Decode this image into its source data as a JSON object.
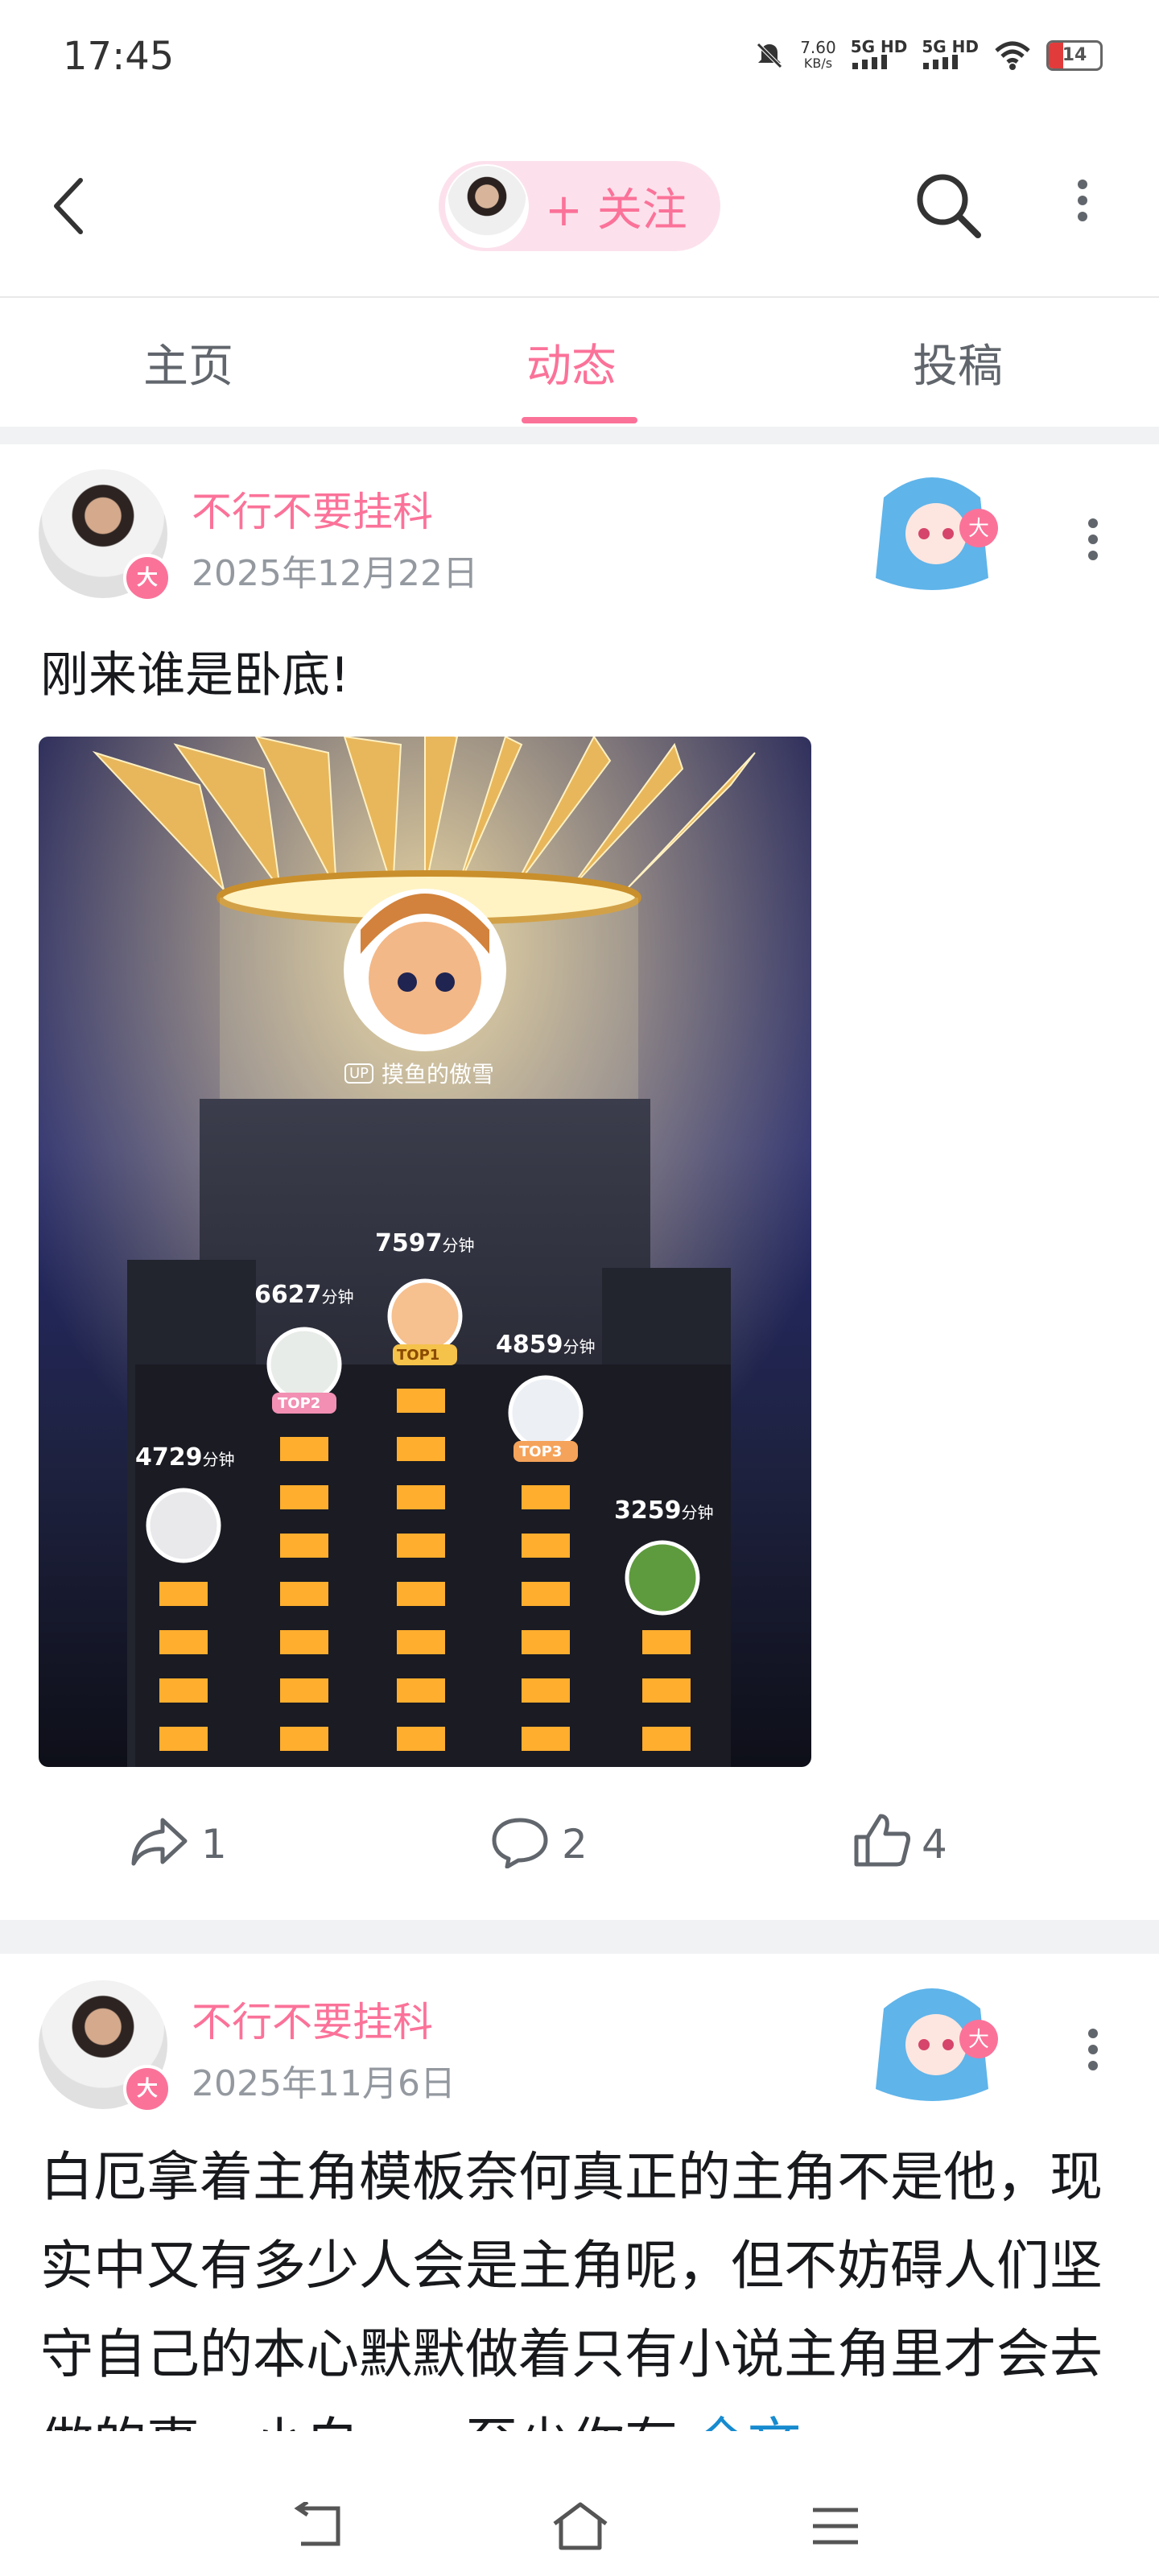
{
  "status_bar": {
    "time": "17:45",
    "net_speed_value": "7.60",
    "net_speed_unit": "KB/s",
    "signal1": "5G HD",
    "signal2": "5G HD",
    "battery": "14"
  },
  "header": {
    "follow_label": "+ 关注"
  },
  "tabs": [
    {
      "label": "主页"
    },
    {
      "label": "动态"
    },
    {
      "label": "投稿"
    }
  ],
  "posts": [
    {
      "username": "不行不要挂科",
      "date": "2025年12月22日",
      "badge": "大",
      "text": "刚来谁是卧底!",
      "image": {
        "top_user": "摸鱼的傲雪",
        "top_user_tag": "UP",
        "ranks": [
          {
            "minutes": "7597",
            "unit": "分钟",
            "rank": "TOP1"
          },
          {
            "minutes": "6627",
            "unit": "分钟",
            "rank": "TOP2"
          },
          {
            "minutes": "4859",
            "unit": "分钟",
            "rank": "TOP3"
          },
          {
            "minutes": "4729",
            "unit": "分钟",
            "rank": ""
          },
          {
            "minutes": "3259",
            "unit": "分钟",
            "rank": ""
          }
        ]
      },
      "shares": "1",
      "comments": "2",
      "likes": "4"
    },
    {
      "username": "不行不要挂科",
      "date": "2025年11月6日",
      "badge": "大",
      "text": "白厄拿着主角模板奈何真正的主角不是他，现实中又有多少人会是主角呢，但不妨碍人们坚守自己的本心默默做着只有小说主角里才会去做的事，小白……至少你有",
      "more_label": "全文"
    }
  ],
  "colors": {
    "accent": "#fb7299",
    "secondary_text": "#9499a0",
    "link": "#178bcf"
  }
}
